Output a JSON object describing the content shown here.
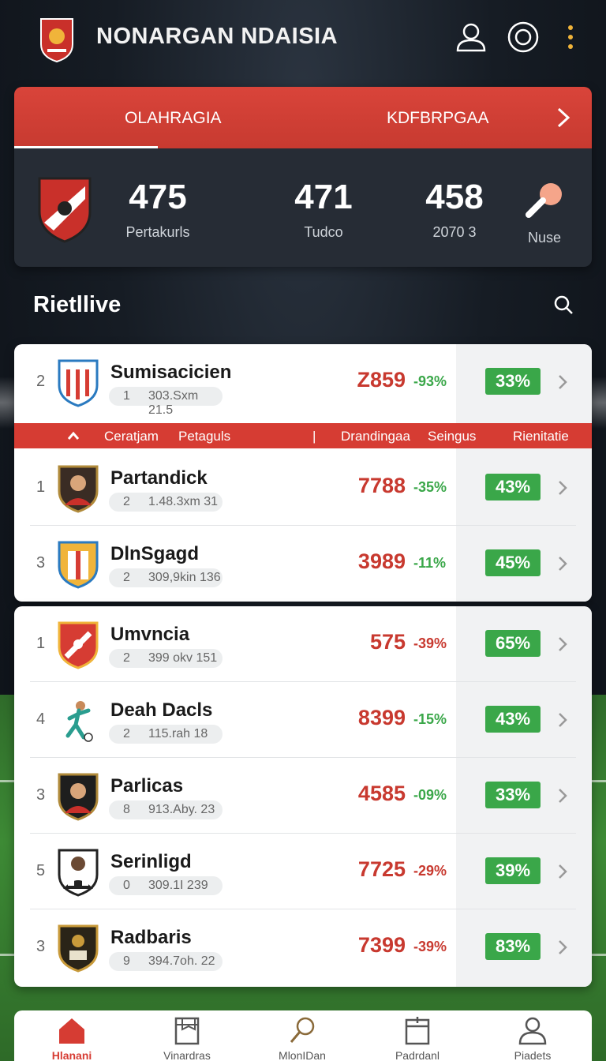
{
  "header": {
    "title": "NONARGAN NDAISIA",
    "icons": [
      "logo-shield-icon",
      "user-icon",
      "target-icon",
      "more-dots-icon"
    ]
  },
  "stats_panel": {
    "tabs": [
      "OLAHRAGIA",
      "KDFBRPGAA"
    ],
    "stats": [
      {
        "value": "475",
        "label": "Pertakurls"
      },
      {
        "value": "471",
        "label": "Tudco"
      },
      {
        "value": "458",
        "label": "2070 3"
      }
    ],
    "mic_label": "Nuse"
  },
  "section": {
    "title": "Rietllive"
  },
  "column_headers": [
    "Ceratjam",
    "Petaguls",
    "|",
    "Drandingaa",
    "Seingus",
    "Rienitatie"
  ],
  "top_row": {
    "rank": "2",
    "name": "Sumisacicien",
    "n": "1",
    "detail": "303.Sxm 21.5",
    "value": "Z859",
    "delta": "-93%",
    "pct": "33%"
  },
  "group1": [
    {
      "rank": "1",
      "name": "Partandick",
      "n": "2",
      "detail": "1.48.3xm 31",
      "value": "7788",
      "delta": "-35%",
      "pct": "43%"
    },
    {
      "rank": "3",
      "name": "DlnSgagd",
      "n": "2",
      "detail": "309,9kin 136",
      "value": "3989",
      "delta": "-11%",
      "pct": "45%"
    }
  ],
  "group2": [
    {
      "rank": "1",
      "name": "Umvncia",
      "n": "2",
      "detail": "399 okv 151",
      "value": "575",
      "delta": "-39%",
      "pct": "65%"
    },
    {
      "rank": "4",
      "name": "Deah Dacls",
      "n": "2",
      "detail": "115.rah 18",
      "value": "8399",
      "delta": "-15%",
      "pct": "43%"
    },
    {
      "rank": "3",
      "name": "Parlicas",
      "n": "8",
      "detail": "913.Aby. 23",
      "value": "4585",
      "delta": "-09%",
      "pct": "33%"
    },
    {
      "rank": "5",
      "name": "Serinligd",
      "n": "0",
      "detail": "309.1I 239",
      "value": "7725",
      "delta": "-29%",
      "pct": "39%"
    },
    {
      "rank": "3",
      "name": "Radbaris",
      "n": "9",
      "detail": "394.7oh. 22",
      "value": "7399",
      "delta": "-39%",
      "pct": "83%"
    }
  ],
  "bottom_nav": [
    {
      "label": "Hlanani",
      "icon": "home-icon",
      "active": true
    },
    {
      "label": "Vinardras",
      "icon": "calendar-icon",
      "active": false
    },
    {
      "label": "MlonIDan",
      "icon": "search-icon",
      "active": false
    },
    {
      "label": "Padrdanl",
      "icon": "clipboard-icon",
      "active": false
    },
    {
      "label": "Piadets",
      "icon": "user-icon",
      "active": false
    }
  ],
  "colors": {
    "accent": "#d63c33",
    "positive": "#3aa749",
    "value_red": "#c8392f",
    "panel": "#262c35"
  }
}
